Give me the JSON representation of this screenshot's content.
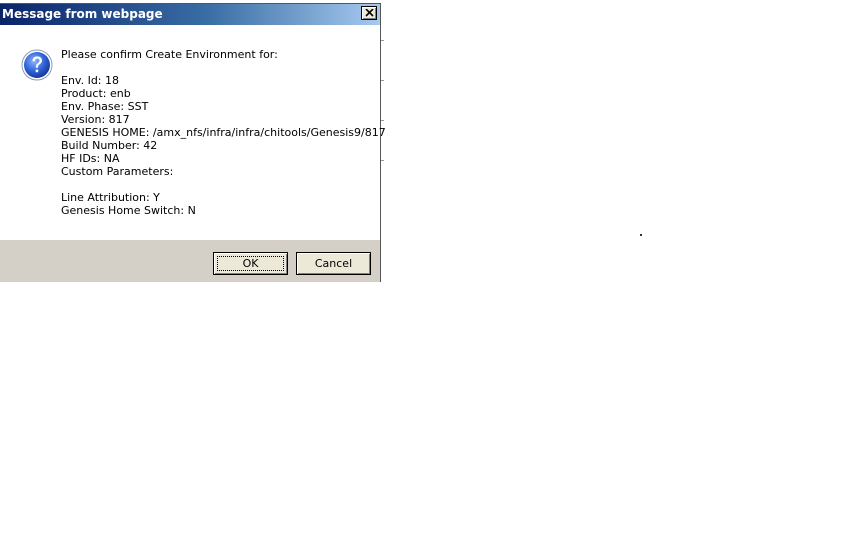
{
  "dialog": {
    "title": "Message from webpage",
    "close_label": "✕",
    "icon": "question-icon",
    "prompt": "Please confirm Create Environment for:",
    "fields": [
      "Env. Id: 18",
      "Product: enb",
      "Env. Phase: SST",
      "Version: 817",
      "GENESIS HOME: /amx_nfs/infra/infra/chitools/Genesis9/817",
      "Build Number: 42",
      "HF IDs: NA",
      "Custom Parameters:"
    ],
    "extra_fields": [
      "Line Attribution: Y",
      "Genesis Home Switch: N"
    ],
    "ok_label": "OK",
    "cancel_label": "Cancel"
  },
  "colors": {
    "titlebar_start": "#0a246a",
    "titlebar_end": "#a6caf0",
    "footer": "#d4d0c8"
  }
}
